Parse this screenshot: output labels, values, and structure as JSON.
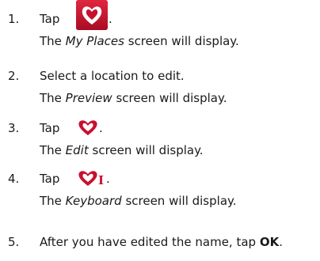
{
  "steps": [
    {
      "number": "1.",
      "action": "Tap",
      "action_suffix": ".",
      "icon": "heart-button-icon",
      "result_screen": "My Places",
      "result_text": "screen will display."
    },
    {
      "number": "2.",
      "action": "Select a location to edit.",
      "result_screen": "Preview",
      "result_text": "screen will display."
    },
    {
      "number": "3.",
      "action": "Tap",
      "action_suffix": ".",
      "icon": "heart-outline-icon",
      "result_screen": "Edit",
      "result_text": "screen will display."
    },
    {
      "number": "4.",
      "action": "Tap",
      "action_suffix": ".",
      "icon": "heart-edit-icon",
      "icon_cursor": "I",
      "result_screen": "Keyboard",
      "result_text": "screen will display."
    },
    {
      "number": "5.",
      "action": "After you have edited the name, tap",
      "action_bold": "OK",
      "action_suffix": "."
    }
  ],
  "colors": {
    "accent": "#c8102e",
    "text": "#1a1a1a"
  }
}
